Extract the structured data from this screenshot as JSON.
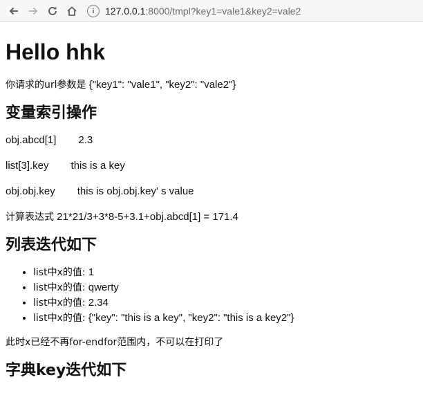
{
  "browser": {
    "url_host": "127.0.0.1",
    "url_rest": ":8000/tmpl?key1=vale1&key2=vale2"
  },
  "page": {
    "title": "Hello hhk",
    "intro_prefix": "你请求的url参数是",
    "intro_value": "{\"key1\": \"vale1\", \"key2\": \"vale2\"}",
    "section_index": "变量索引操作",
    "index_ops": [
      {
        "expr": "obj.abcd[1]",
        "value": "2.3"
      },
      {
        "expr": "list[3].key",
        "value": "this is a key"
      },
      {
        "expr": "obj.obj.key",
        "value": "this is obj.obj.key' s value"
      }
    ],
    "calc_prefix": "计算表达式",
    "calc_expr": "21*21/3+3*8-5+3.1+obj.abcd[1]  =  171.4",
    "section_list": "列表迭代如下",
    "list_items": [
      {
        "label": "list中x的值:",
        "value": "1"
      },
      {
        "label": "list中x的值:",
        "value": "qwerty"
      },
      {
        "label": "list中x的值:",
        "value": "2.34"
      },
      {
        "label": "list中x的值:",
        "value": "{\"key\": \"this is a key\", \"key2\": \"this is a key2\"}"
      }
    ],
    "after_loop": "此时x已经不再for-endfor范围内，不可以在打印了",
    "section_dict": "字典key迭代如下"
  }
}
